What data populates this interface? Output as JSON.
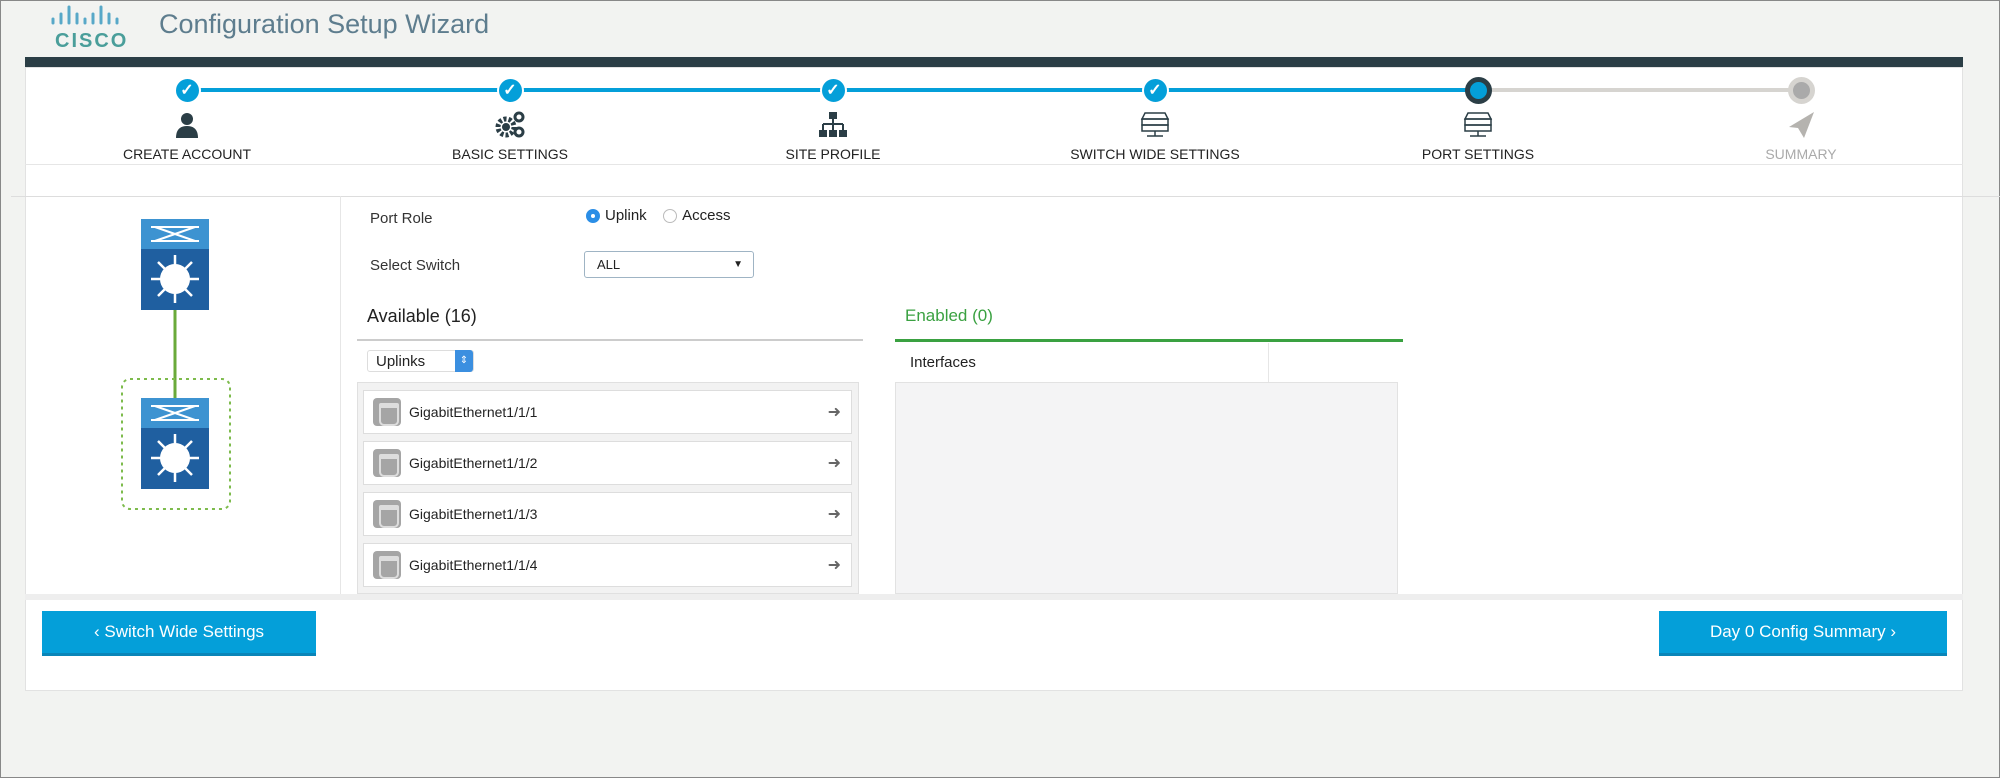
{
  "header": {
    "title": "Configuration Setup Wizard",
    "logo": "cisco"
  },
  "steps": [
    {
      "label": "CREATE ACCOUNT",
      "state": "done",
      "icon": "user-icon"
    },
    {
      "label": "BASIC SETTINGS",
      "state": "done",
      "icon": "gears-icon"
    },
    {
      "label": "SITE PROFILE",
      "state": "done",
      "icon": "sitemap-icon"
    },
    {
      "label": "SWITCH WIDE SETTINGS",
      "state": "done",
      "icon": "server-icon"
    },
    {
      "label": "PORT SETTINGS",
      "state": "current",
      "icon": "server-icon"
    },
    {
      "label": "SUMMARY",
      "state": "future",
      "icon": "paper-plane-icon"
    }
  ],
  "check": "✓",
  "form": {
    "port_role_label": "Port Role",
    "port_role_options": [
      "Uplink",
      "Access"
    ],
    "port_role_selected": "Uplink",
    "select_switch_label": "Select Switch",
    "select_switch_value": "ALL"
  },
  "available": {
    "title": "Available (16)",
    "filter": "Uplinks",
    "items": [
      "GigabitEthernet1/1/1",
      "GigabitEthernet1/1/2",
      "GigabitEthernet1/1/3",
      "GigabitEthernet1/1/4"
    ]
  },
  "enabled": {
    "title": "Enabled (0)",
    "column": "Interfaces"
  },
  "buttons": {
    "back": "‹ Switch Wide Settings",
    "next": "Day 0 Config Summary ›"
  },
  "colors": {
    "accent": "#049fd9",
    "dark": "#2b3e46",
    "green": "#3aa141"
  }
}
